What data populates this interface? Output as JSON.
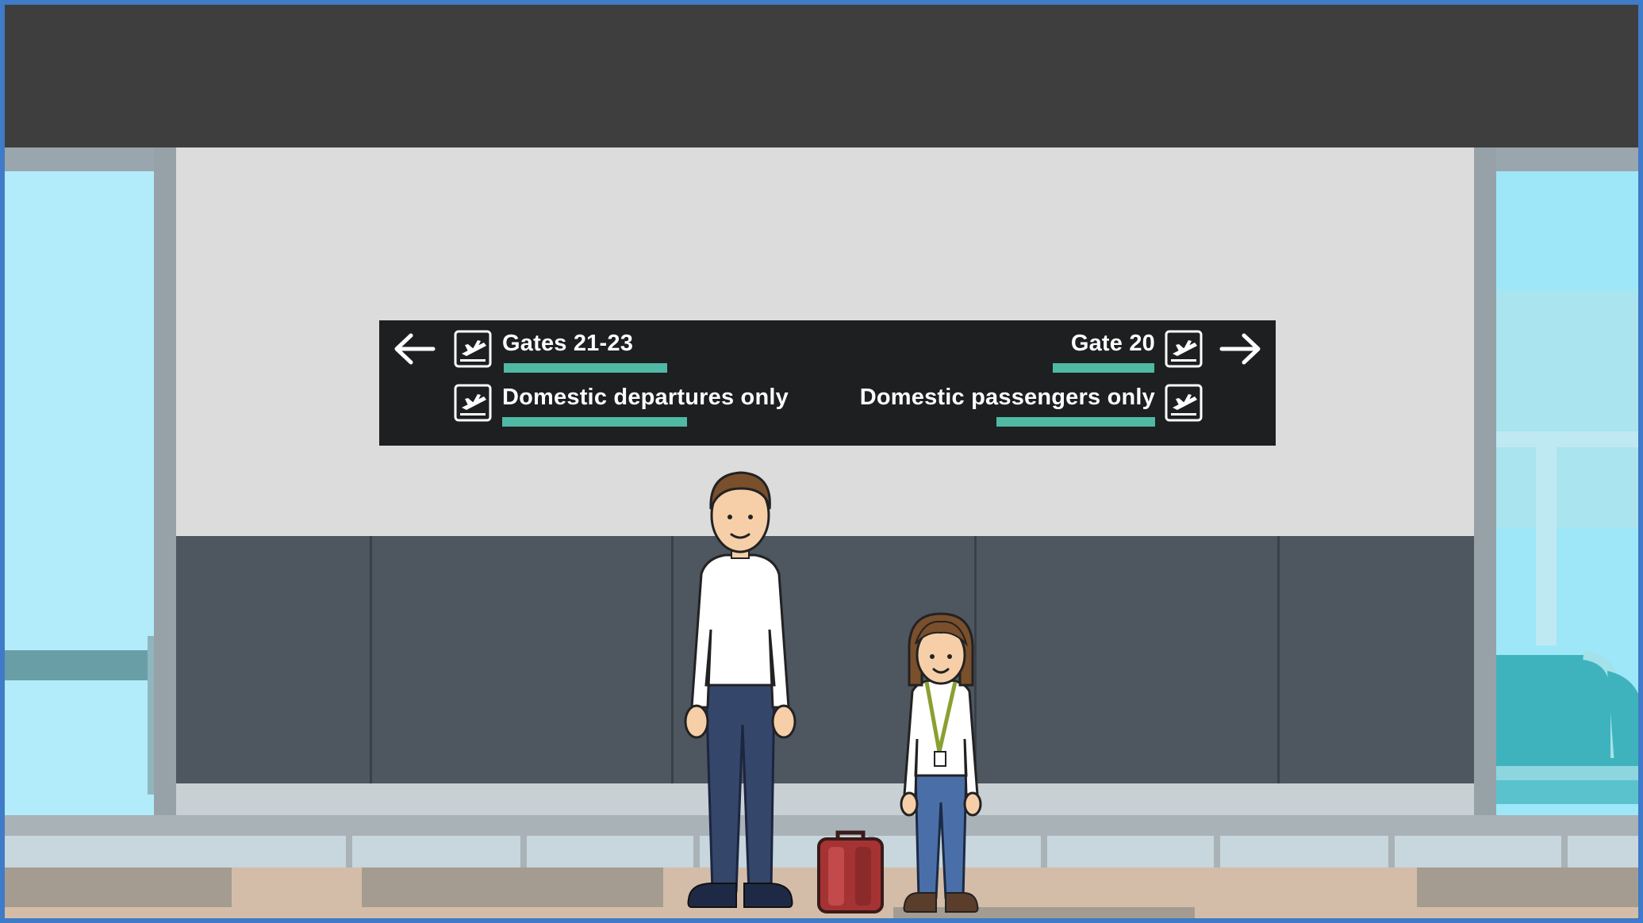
{
  "sign": {
    "left_top": "Gates 21-23",
    "left_bottom": "Domestic departures only",
    "right_top": "Gate 20",
    "right_bottom": "Domestic passengers only"
  },
  "icons": {
    "left_arrow": "arrow-left-icon",
    "right_arrow": "arrow-right-icon",
    "departures": "airplane-departure-icon"
  },
  "colors": {
    "sign_background": "#1e1f20",
    "sign_accent": "#4fb9a4",
    "frame_border": "#3f7bc7"
  }
}
